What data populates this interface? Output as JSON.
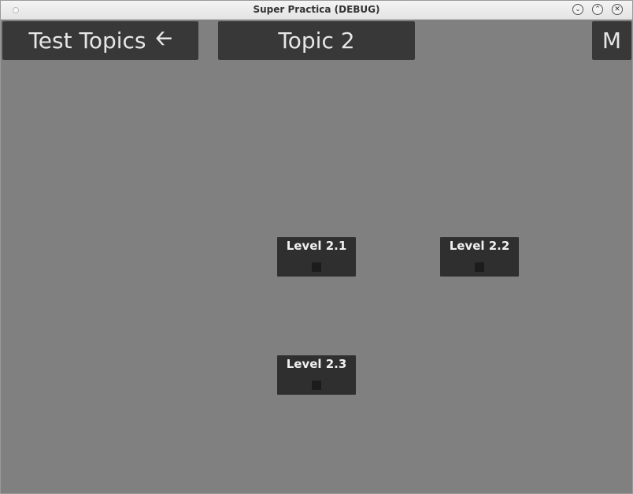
{
  "window": {
    "title": "Super Practica (DEBUG)",
    "controls": {
      "minimize_icon": "chevron-down-icon",
      "maximize_icon": "chevron-up-icon",
      "close_icon": "close-icon"
    }
  },
  "header": {
    "back_label": "Test Topics",
    "back_icon": "arrow-left-icon",
    "topic_title": "Topic 2",
    "menu_label": "M"
  },
  "levels": [
    {
      "label": "Level 2.1"
    },
    {
      "label": "Level 2.2"
    },
    {
      "label": "Level 2.3"
    }
  ],
  "colors": {
    "background": "#808080",
    "button": "#383838",
    "card": "#2f2f2f",
    "indicator": "#1c1c1c",
    "text": "#e6e6e6"
  }
}
